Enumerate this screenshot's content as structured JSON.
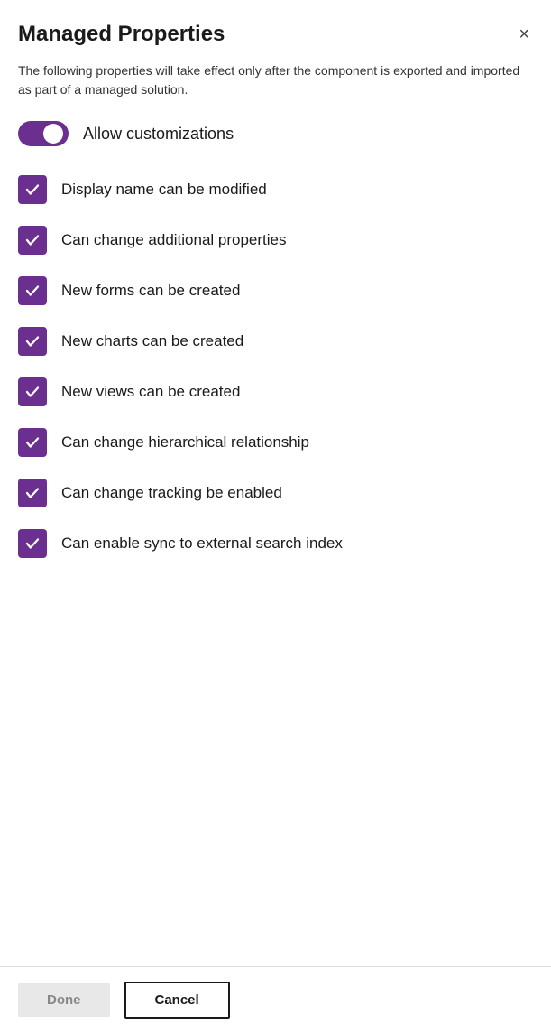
{
  "dialog": {
    "title": "Managed Properties",
    "description": "The following properties will take effect only after the component is exported and imported as part of a managed solution.",
    "close_label": "×"
  },
  "toggle": {
    "label": "Allow customizations",
    "checked": true
  },
  "checkboxes": [
    {
      "id": "display-name",
      "label": "Display name can be modified",
      "checked": true
    },
    {
      "id": "additional-props",
      "label": "Can change additional properties",
      "checked": true
    },
    {
      "id": "new-forms",
      "label": "New forms can be created",
      "checked": true
    },
    {
      "id": "new-charts",
      "label": "New charts can be created",
      "checked": true
    },
    {
      "id": "new-views",
      "label": "New views can be created",
      "checked": true
    },
    {
      "id": "hierarchical",
      "label": "Can change hierarchical relationship",
      "checked": true
    },
    {
      "id": "tracking",
      "label": "Can change tracking be enabled",
      "checked": true
    },
    {
      "id": "sync-search",
      "label": "Can enable sync to external search index",
      "checked": true
    }
  ],
  "footer": {
    "done_label": "Done",
    "cancel_label": "Cancel"
  }
}
